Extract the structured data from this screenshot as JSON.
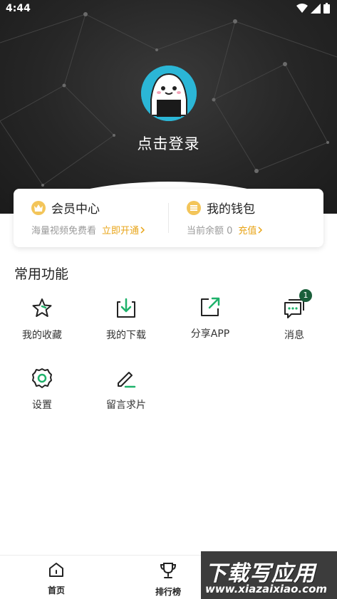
{
  "status_bar": {
    "time": "4:44"
  },
  "profile": {
    "login_label": "点击登录"
  },
  "vip_card": {
    "title": "会员中心",
    "subtitle": "海量视频免费看",
    "action": "立即开通"
  },
  "wallet_card": {
    "title": "我的钱包",
    "subtitle": "当前余额 0",
    "action": "充值"
  },
  "functions": {
    "section_title": "常用功能",
    "items": [
      {
        "label": "我的收藏",
        "icon": "star-icon"
      },
      {
        "label": "我的下载",
        "icon": "download-icon"
      },
      {
        "label": "分享APP",
        "icon": "share-icon"
      },
      {
        "label": "消息",
        "icon": "message-icon",
        "badge": "1"
      },
      {
        "label": "设置",
        "icon": "gear-icon"
      },
      {
        "label": "留言求片",
        "icon": "edit-icon"
      }
    ]
  },
  "tabbar": {
    "tabs": [
      {
        "label": "首页",
        "icon": "home-icon"
      },
      {
        "label": "排行榜",
        "icon": "trophy-icon"
      }
    ]
  },
  "watermark": {
    "title": "下载写应用",
    "url": "www.xiazaixiao.com"
  },
  "colors": {
    "accent_green": "#1fb26b",
    "gold": "#e8a417",
    "hero_bg": "#262626"
  }
}
